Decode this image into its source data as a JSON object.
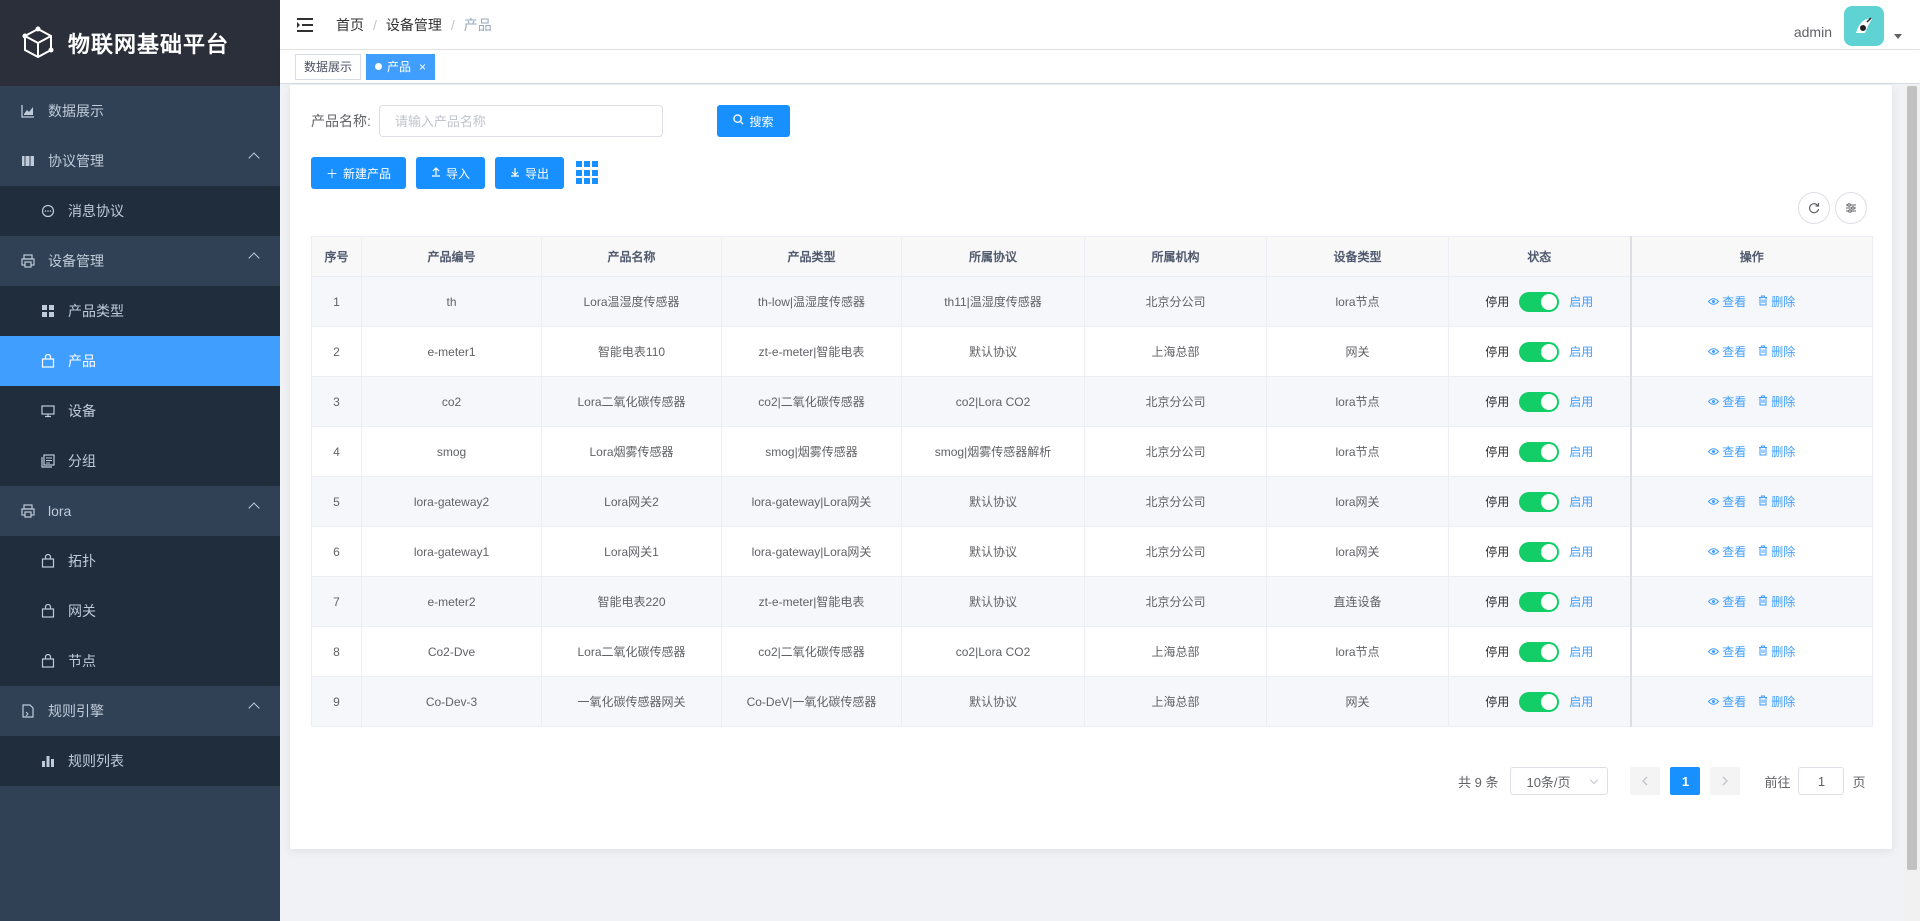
{
  "app": {
    "title": "物联网基础平台"
  },
  "sidebar": {
    "items": [
      {
        "label": "数据展示",
        "icon": "chart-icon",
        "level": 0
      },
      {
        "label": "协议管理",
        "icon": "document-icon",
        "level": 0,
        "expanded": true
      },
      {
        "label": "消息协议",
        "icon": "message-icon",
        "level": 1
      },
      {
        "label": "设备管理",
        "icon": "printer-icon",
        "level": 0,
        "expanded": true
      },
      {
        "label": "产品类型",
        "icon": "grid-icon",
        "level": 1
      },
      {
        "label": "产品",
        "icon": "bag-icon",
        "level": 1,
        "active": true
      },
      {
        "label": "设备",
        "icon": "monitor-icon",
        "level": 1
      },
      {
        "label": "分组",
        "icon": "copy-icon",
        "level": 1
      },
      {
        "label": "lora",
        "icon": "printer-icon",
        "level": 0,
        "expanded": true
      },
      {
        "label": "拓扑",
        "icon": "bag-icon",
        "level": 1
      },
      {
        "label": "网关",
        "icon": "bag-icon",
        "level": 1
      },
      {
        "label": "节点",
        "icon": "bag-icon",
        "level": 1
      },
      {
        "label": "规则引擎",
        "icon": "file-icon",
        "level": 0,
        "expanded": true
      },
      {
        "label": "规则列表",
        "icon": "bar-chart-icon",
        "level": 1
      }
    ]
  },
  "header": {
    "breadcrumb": [
      "首页",
      "设备管理",
      "产品"
    ],
    "user": "admin"
  },
  "tags": [
    {
      "label": "数据展示",
      "active": false
    },
    {
      "label": "产品",
      "active": true,
      "close": "×"
    }
  ],
  "search": {
    "label": "产品名称:",
    "placeholder": "请输入产品名称",
    "button": "搜索"
  },
  "toolbar": {
    "add": "新建产品",
    "import": "导入",
    "export": "导出"
  },
  "table": {
    "columns": [
      "序号",
      "产品编号",
      "产品名称",
      "产品类型",
      "所属协议",
      "所属机构",
      "设备类型",
      "状态",
      "操作"
    ],
    "status_off": "停用",
    "status_on": "启用",
    "view": "查看",
    "delete": "删除",
    "rows": [
      [
        "1",
        "th",
        "Lora温湿度传感器",
        "th-low|温湿度传感器",
        "th11|温湿度传感器",
        "北京分公司",
        "lora节点"
      ],
      [
        "2",
        "e-meter1",
        "智能电表110",
        "zt-e-meter|智能电表",
        "默认协议",
        "上海总部",
        "网关"
      ],
      [
        "3",
        "co2",
        "Lora二氧化碳传感器",
        "co2|二氧化碳传感器",
        "co2|Lora CO2",
        "北京分公司",
        "lora节点"
      ],
      [
        "4",
        "smog",
        "Lora烟雾传感器",
        "smog|烟雾传感器",
        "smog|烟雾传感器解析",
        "北京分公司",
        "lora节点"
      ],
      [
        "5",
        "lora-gateway2",
        "Lora网关2",
        "lora-gateway|Lora网关",
        "默认协议",
        "北京分公司",
        "lora网关"
      ],
      [
        "6",
        "lora-gateway1",
        "Lora网关1",
        "lora-gateway|Lora网关",
        "默认协议",
        "北京分公司",
        "lora网关"
      ],
      [
        "7",
        "e-meter2",
        "智能电表220",
        "zt-e-meter|智能电表",
        "默认协议",
        "北京分公司",
        "直连设备"
      ],
      [
        "8",
        "Co2-Dve",
        "Lora二氧化碳传感器",
        "co2|二氧化碳传感器",
        "co2|Lora CO2",
        "上海总部",
        "lora节点"
      ],
      [
        "9",
        "Co-Dev-3",
        "一氧化碳传感器网关",
        "Co-DeV|一氧化碳传感器",
        "默认协议",
        "上海总部",
        "网关"
      ]
    ]
  },
  "pagination": {
    "total": "共 9 条",
    "page_size": "10条/页",
    "current": "1",
    "goto_label": "前往",
    "goto_value": "1",
    "page_suffix": "页"
  }
}
